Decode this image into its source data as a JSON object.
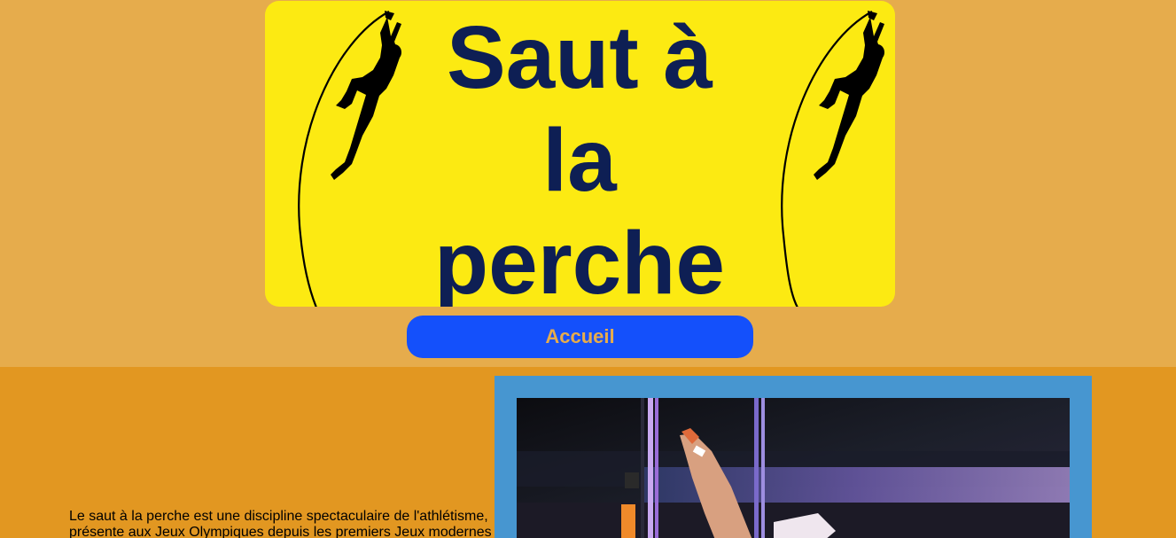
{
  "header": {
    "title": "Saut à la perche",
    "title_color": "#0e1f54",
    "banner_color": "#fcea12"
  },
  "nav": {
    "home_label": "Accueil",
    "button_color": "#1450fb"
  },
  "main": {
    "intro_text": "Le saut à la perche est une discipline spectaculaire de l'athlétisme, présente aux Jeux Olympiques depuis les premiers Jeux modernes",
    "photo_frame_color": "#4796d0"
  },
  "colors": {
    "page_bg": "#e6ac4c",
    "content_bg": "#e29721"
  },
  "icons": {
    "banner_left": "pole-vaulter-icon",
    "banner_right": "pole-vaulter-icon"
  }
}
